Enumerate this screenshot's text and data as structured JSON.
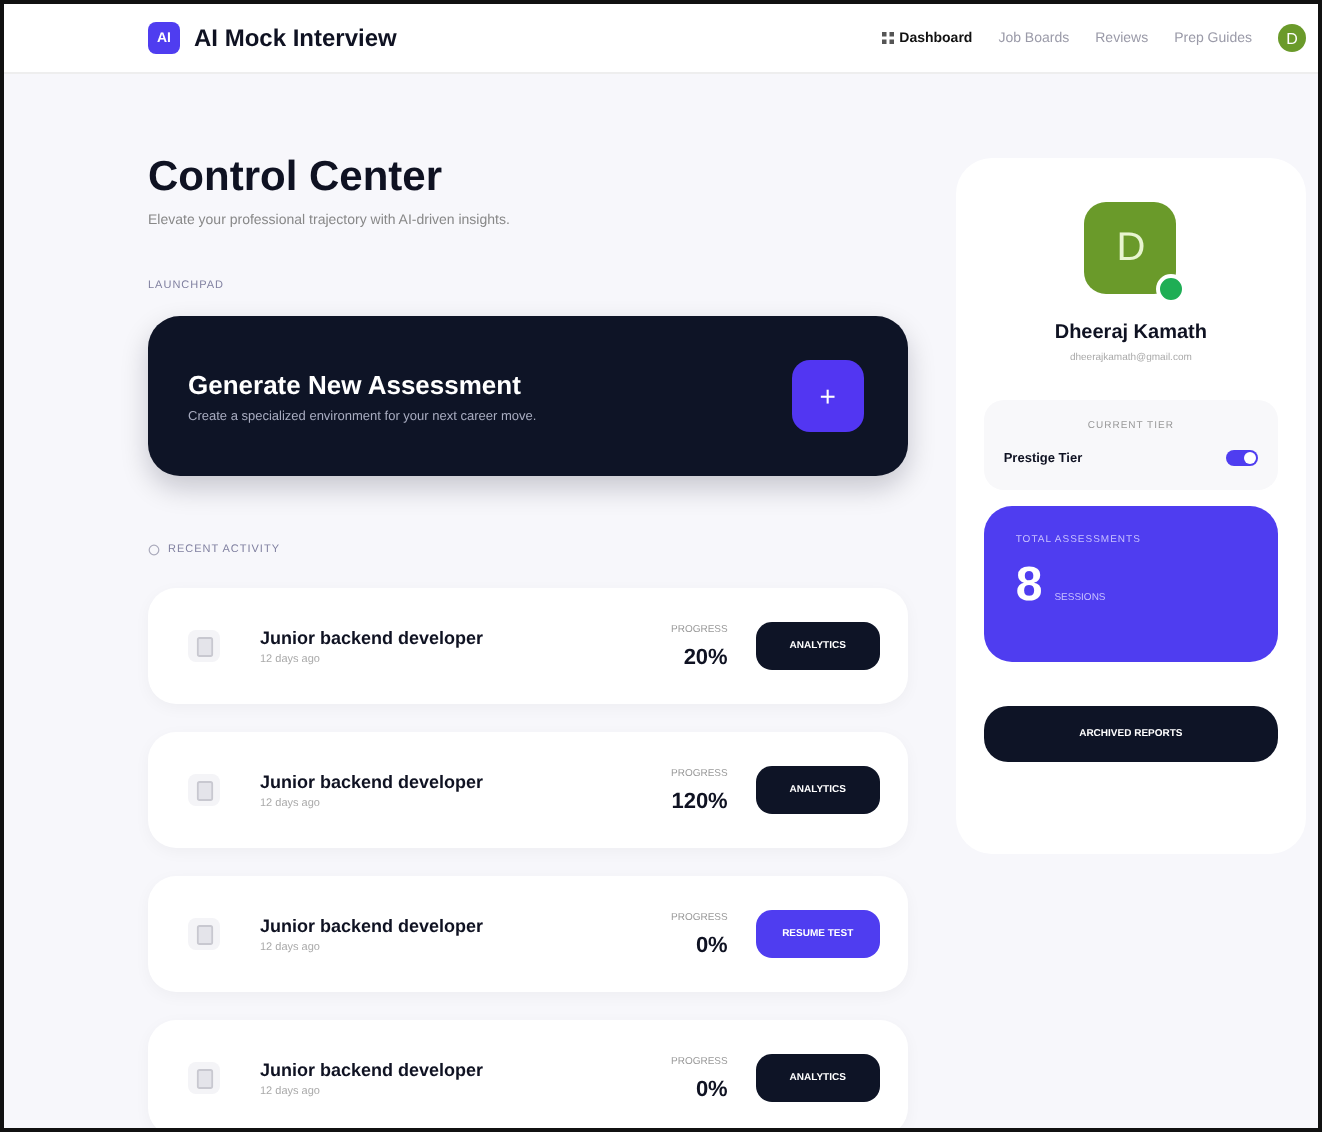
{
  "header": {
    "logo": "AI",
    "title": "AI Mock Interview",
    "nav": [
      {
        "label": "Dashboard",
        "selected": true
      },
      {
        "label": "Job Boards",
        "selected": false
      },
      {
        "label": "Reviews",
        "selected": false
      },
      {
        "label": "Prep Guides",
        "selected": false
      }
    ],
    "avatar": "D"
  },
  "main": {
    "title": "Control Center",
    "subtitle": "Elevate your professional trajectory with AI-driven insights.",
    "section": "LAUNCHPAD",
    "hero": {
      "title": "Generate New Assessment",
      "text": "Create a specialized environment for your next career move.",
      "button": "+"
    },
    "recent_label": "RECENT ACTIVITY",
    "rows": [
      {
        "title": "Junior backend developer",
        "meta": "12 days ago",
        "progress_label": "PROGRESS",
        "progress": "20%",
        "action": {
          "label": "ANALYTICS",
          "kind": "analytics"
        }
      },
      {
        "title": "Junior backend developer",
        "meta": "12 days ago",
        "progress_label": "PROGRESS",
        "progress": "120%",
        "action": {
          "label": "ANALYTICS",
          "kind": "analytics"
        }
      },
      {
        "title": "Junior backend developer",
        "meta": "12 days ago",
        "progress_label": "PROGRESS",
        "progress": "0%",
        "action": {
          "label": "RESUME TEST",
          "kind": "resume"
        }
      },
      {
        "title": "Junior backend developer",
        "meta": "12 days ago",
        "progress_label": "PROGRESS",
        "progress": "0%",
        "action": {
          "label": "ANALYTICS",
          "kind": "analytics"
        }
      }
    ]
  },
  "profile": {
    "initial": "D",
    "online": true,
    "name": "Dheeraj Kamath",
    "email": "dheerajkamath@gmail.com",
    "tier": {
      "label": "CURRENT TIER",
      "name": "Prestige Tier",
      "on": true
    },
    "stats": {
      "label": "TOTAL ASSESSMENTS",
      "value": "8",
      "unit": "SESSIONS"
    },
    "button": "ARCHIVED REPORTS"
  }
}
